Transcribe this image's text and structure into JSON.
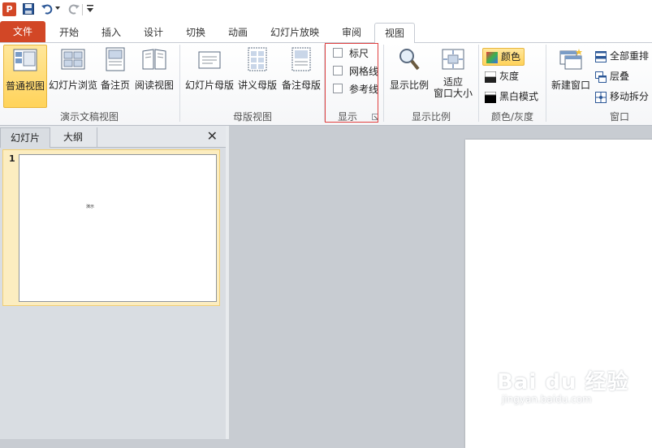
{
  "quick_access": {
    "app_icon": "P",
    "icons": [
      "powerpoint-icon",
      "save-icon",
      "undo-icon",
      "redo-icon",
      "customize-icon"
    ]
  },
  "tabs": [
    {
      "label": "文件"
    },
    {
      "label": "开始"
    },
    {
      "label": "插入"
    },
    {
      "label": "设计"
    },
    {
      "label": "切换"
    },
    {
      "label": "动画"
    },
    {
      "label": "幻灯片放映"
    },
    {
      "label": "审阅"
    },
    {
      "label": "视图"
    }
  ],
  "ribbon": {
    "presentation_views": {
      "label": "演示文稿视图",
      "buttons": [
        "普通视图",
        "幻灯片浏览",
        "备注页",
        "阅读视图"
      ]
    },
    "master_views": {
      "label": "母版视图",
      "buttons": [
        "幻灯片母版",
        "讲义母版",
        "备注母版"
      ]
    },
    "show": {
      "label": "显示",
      "checkboxes": [
        {
          "label": "标尺",
          "checked": false
        },
        {
          "label": "网格线",
          "checked": false
        },
        {
          "label": "参考线",
          "checked": false
        }
      ]
    },
    "zoom": {
      "label": "显示比例",
      "buttons": [
        "显示比例",
        "适应",
        "窗口大小"
      ]
    },
    "color": {
      "label": "颜色/灰度",
      "buttons": [
        "颜色",
        "灰度",
        "黑白模式"
      ]
    },
    "window": {
      "label": "窗口",
      "new_window": "新建窗口",
      "buttons": [
        "全部重排",
        "层叠",
        "移动拆分"
      ]
    }
  },
  "left_pane": {
    "tabs": [
      "幻灯片",
      "大纲"
    ],
    "close": "✕",
    "slides": [
      {
        "number": "1",
        "text": "演示"
      }
    ]
  },
  "watermark": {
    "brand": "Bai du 经验",
    "url": "jingyan.baidu.com"
  },
  "colors": {
    "file_tab": "#d24726",
    "selected_button": "#ffd35a",
    "highlight_box": "#e04040",
    "selected_thumb": "#fcedc0"
  }
}
